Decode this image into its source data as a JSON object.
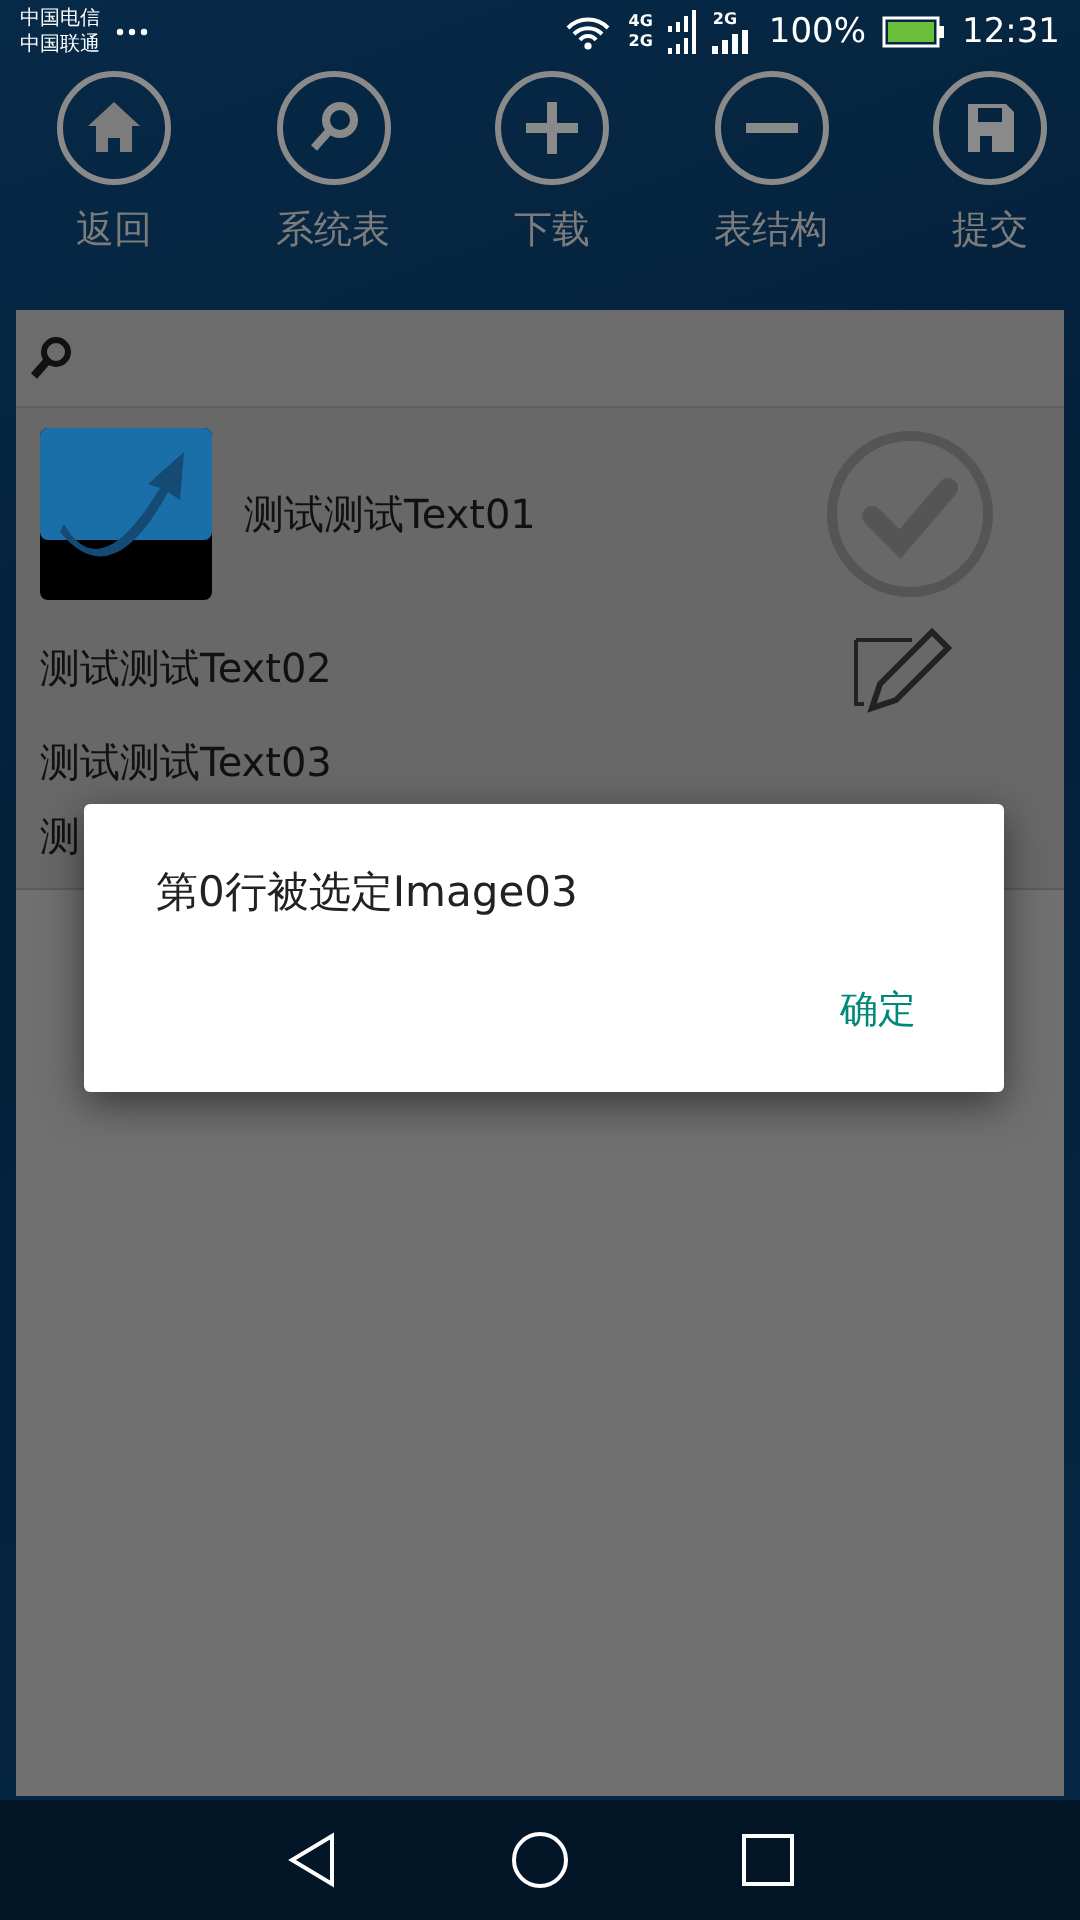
{
  "status_bar": {
    "carriers": [
      "中国电信",
      "中国联通"
    ],
    "network_labels": [
      "4G",
      "2G",
      "2G"
    ],
    "battery": "100%",
    "time": "12:31"
  },
  "toolbar": [
    {
      "kind": "home",
      "label": "返回"
    },
    {
      "kind": "search",
      "label": "系统表"
    },
    {
      "kind": "plus",
      "label": "下载"
    },
    {
      "kind": "minus",
      "label": "表结构"
    },
    {
      "kind": "save",
      "label": "提交"
    }
  ],
  "list": {
    "header_row": {
      "title": "测试测试Text01"
    },
    "rows": [
      "测试测试Text02",
      "测试测试Text03",
      "测"
    ]
  },
  "dialog": {
    "message": "第0行被选定Image03",
    "button": "确定"
  }
}
